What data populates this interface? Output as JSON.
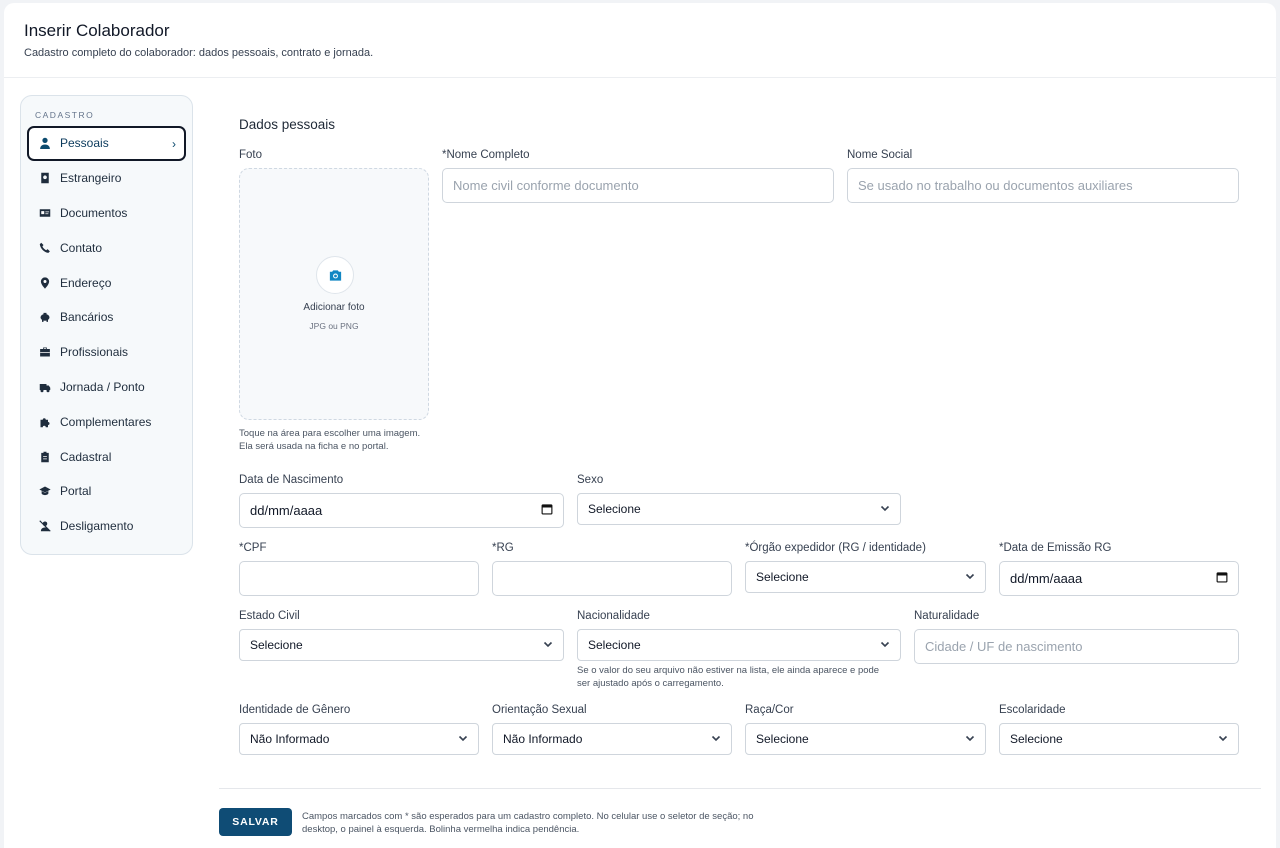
{
  "header": {
    "title": "Inserir Colaborador",
    "subtitle": "Cadastro completo do colaborador: dados pessoais, contrato e jornada."
  },
  "sidebar": {
    "heading": "CADASTRO",
    "active": "Pessoais",
    "items": [
      {
        "label": "Pessoais",
        "icon": "person-icon"
      },
      {
        "label": "Estrangeiro",
        "icon": "passport-icon"
      },
      {
        "label": "Documentos",
        "icon": "id-card-icon"
      },
      {
        "label": "Contato",
        "icon": "phone-icon"
      },
      {
        "label": "Endereço",
        "icon": "map-pin-icon"
      },
      {
        "label": "Bancários",
        "icon": "piggy-bank-icon"
      },
      {
        "label": "Profissionais",
        "icon": "briefcase-icon"
      },
      {
        "label": "Jornada / Ponto",
        "icon": "truck-clock-icon"
      },
      {
        "label": "Complementares",
        "icon": "puzzle-icon"
      },
      {
        "label": "Cadastral",
        "icon": "clipboard-icon"
      },
      {
        "label": "Portal",
        "icon": "graduation-cap-icon"
      },
      {
        "label": "Desligamento",
        "icon": "user-slash-icon"
      }
    ]
  },
  "form": {
    "section_title": "Dados pessoais",
    "photo": {
      "label": "Foto",
      "cta": "Adicionar foto",
      "formats": "JPG ou PNG",
      "help_line1": "Toque na área para escolher uma imagem.",
      "help_line2": "Ela será usada na ficha e no portal."
    },
    "nome_completo": {
      "label": "*Nome Completo",
      "placeholder": "Nome civil conforme documento",
      "value": ""
    },
    "nome_social": {
      "label": "Nome Social",
      "placeholder": "Se usado no trabalho ou documentos auxiliares",
      "value": ""
    },
    "data_nascimento": {
      "label": "Data de Nascimento",
      "value": "dd/mm/aaaa"
    },
    "sexo": {
      "label": "Sexo",
      "value": "Selecione"
    },
    "cpf": {
      "label": "*CPF",
      "value": ""
    },
    "rg": {
      "label": "*RG",
      "value": ""
    },
    "orgao_expedidor": {
      "label": "*Órgão expedidor (RG / identidade)",
      "value": "Selecione"
    },
    "data_emissao_rg": {
      "label": "*Data de Emissão RG",
      "value": "dd/mm/aaaa"
    },
    "estado_civil": {
      "label": "Estado Civil",
      "value": "Selecione"
    },
    "nacionalidade": {
      "label": "Nacionalidade",
      "value": "Selecione",
      "help_line1": "Se o valor do seu arquivo não estiver na lista, ele ainda aparece e pode",
      "help_line2": "ser ajustado após o carregamento."
    },
    "naturalidade": {
      "label": "Naturalidade",
      "placeholder": "Cidade / UF de nascimento",
      "value": ""
    },
    "identidade_genero": {
      "label": "Identidade de Gênero",
      "value": "Não Informado"
    },
    "orientacao_sexual": {
      "label": "Orientação Sexual",
      "value": "Não Informado"
    },
    "raca_cor": {
      "label": "Raça/Cor",
      "value": "Selecione"
    },
    "escolaridade": {
      "label": "Escolaridade",
      "value": "Selecione"
    }
  },
  "footer": {
    "save_label": "SALVAR",
    "note_line1": "Campos marcados com * são esperados para um cadastro completo. No celular use o seletor de seção; no",
    "note_line2": "desktop, o painel à esquerda. Bolinha vermelha indica pendência."
  },
  "colors": {
    "accent": "#0f4c75",
    "icon_blue": "#1287c3"
  }
}
